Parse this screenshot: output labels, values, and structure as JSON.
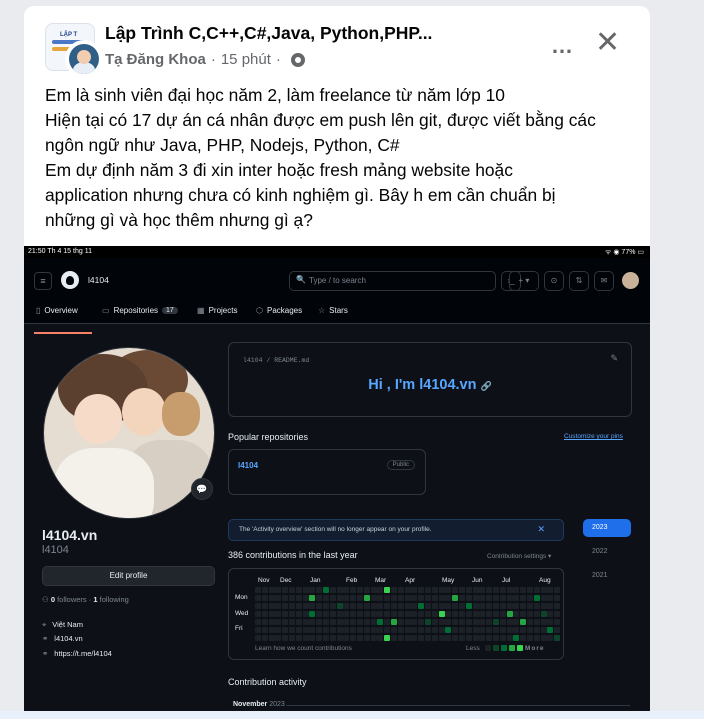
{
  "post": {
    "group_name": "Lập Trình C,C++,C#,Java, Python,PHP...",
    "author": "Tạ Đăng Khoa",
    "time": "15 phút",
    "group_thumb_text": "LẬP T",
    "lines": [
      "Em là sinh viên đại học năm 2, làm freelance từ năm lớp 10",
      "Hiện tại có 17 dự án cá nhân được em push lên git, được viết bằng các",
      "ngôn ngữ như Java, PHP, Nodejs, Python, C#",
      "Em dự định năm 3 đi xin inter hoặc fresh mảng website hoặc",
      "application nhưng chưa có kinh nghiệm gì. Bây h em cần chuẩn bị",
      "những gì và học thêm nhưng gì ạ?"
    ],
    "more_icon": "…",
    "close_icon": "✕"
  },
  "screenshot": {
    "status_left": "21:50  Th 4 15 thg 11",
    "status_right": "ᯤ ◉ 77% ▭",
    "nav": {
      "user": "l4104",
      "search_placeholder": "Type / to search",
      "search_icon": "🔍",
      "cmd_icon": "›_",
      "plus_label": "+ ▾",
      "tabs": [
        {
          "icon": "▯",
          "label": "Overview"
        },
        {
          "icon": "▭",
          "label": "Repositories",
          "count": "17"
        },
        {
          "icon": "▦",
          "label": "Projects"
        },
        {
          "icon": "⬡",
          "label": "Packages"
        },
        {
          "icon": "☆",
          "label": "Stars"
        }
      ]
    },
    "profile": {
      "name": "l4104.vn",
      "login": "l4104",
      "edit_label": "Edit profile",
      "followers": "0",
      "followers_label": "followers",
      "following": "1",
      "following_label": "following",
      "location": "Việt Nam",
      "website": "l4104.vn",
      "link": "https://t.me/l4104",
      "emoji_badge": "💬"
    },
    "readme": {
      "path": "l4104 / README.md",
      "heading": "Hi , I'm l4104.vn",
      "heading_icon": "🔗"
    },
    "popular": {
      "title": "Popular repositories",
      "customize": "Customize your pins",
      "repo_name": "l4104",
      "repo_visibility": "Public"
    },
    "notice": {
      "text": "The 'Activity overview' section will no longer appear on your profile.",
      "close": "✕"
    },
    "years": [
      "2023",
      "2022",
      "2021"
    ],
    "contrib": {
      "title": "386 contributions in the last year",
      "settings": "Contribution settings ▾",
      "months": [
        "Nov",
        "Dec",
        "Jan",
        "Feb",
        "Mar",
        "Apr",
        "May",
        "Jun",
        "Jul",
        "Aug"
      ],
      "days": [
        "Mon",
        "Wed",
        "Fri"
      ],
      "learn": "Learn how we count contributions",
      "less": "Less",
      "more": "More"
    },
    "activity": {
      "title": "Contribution activity",
      "month": "November",
      "year": "2023"
    }
  }
}
